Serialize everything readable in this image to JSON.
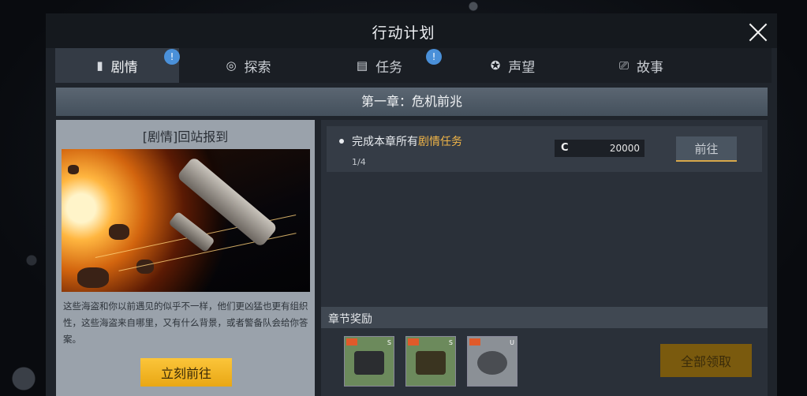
{
  "window": {
    "title": "行动计划"
  },
  "tabs": [
    {
      "label": "剧情",
      "icon": "book-icon",
      "active": true,
      "badge": "!"
    },
    {
      "label": "探索",
      "icon": "compass-icon",
      "active": false
    },
    {
      "label": "任务",
      "icon": "list-icon",
      "active": false,
      "badge": "!"
    },
    {
      "label": "声望",
      "icon": "medal-icon",
      "active": false
    },
    {
      "label": "故事",
      "icon": "story-icon",
      "active": false
    }
  ],
  "chapter": {
    "title": "第一章：危机前兆"
  },
  "story": {
    "title": "[剧情]回站报到",
    "description": "这些海盗和你以前遇见的似乎不一样，他们更凶猛也更有组织性，这些海盗来自哪里，又有什么背景，或者警备队会给你答案。",
    "go_button": "立刻前往"
  },
  "task": {
    "prefix": "完成本章所有",
    "highlight": "剧情任务",
    "progress": "1/4",
    "reward_currency": "C",
    "reward_amount": "20000",
    "button": "前往"
  },
  "chapter_rewards": {
    "title": "章节奖励",
    "items": [
      {
        "icon": "cannon-module-icon",
        "grade": "S"
      },
      {
        "icon": "turret-module-icon",
        "grade": "S"
      },
      {
        "icon": "engine-module-icon",
        "grade": "U"
      }
    ],
    "claim_all": "全部领取"
  },
  "colors": {
    "accent": "#f0b548",
    "badge": "#4a90d9",
    "button_gold": "#f5b727"
  }
}
